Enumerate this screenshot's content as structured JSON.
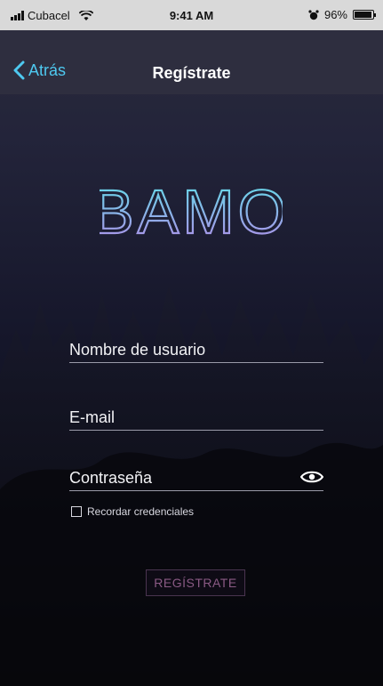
{
  "status_bar": {
    "carrier": "Cubacel",
    "time": "9:41 AM",
    "battery": "96%"
  },
  "nav": {
    "back_label": "Atrás",
    "title": "Regístrate"
  },
  "logo_text": "BAMO",
  "form": {
    "username_placeholder": "Nombre de usuario",
    "email_placeholder": "E-mail",
    "password_placeholder": "Contraseña",
    "remember_label": "Recordar credenciales",
    "submit_label": "REGÍSTRATE"
  },
  "colors": {
    "accent": "#4ec9f0",
    "nav_bg": "#2e2e3f",
    "status_bg": "#d9d9d9",
    "logo_top": "#5ee0e8",
    "logo_bottom": "#b28ae8"
  },
  "icons": {
    "back": "chevron-left-icon",
    "wifi": "wifi-icon",
    "alarm": "alarm-icon",
    "battery": "battery-icon",
    "eye": "eye-icon"
  }
}
